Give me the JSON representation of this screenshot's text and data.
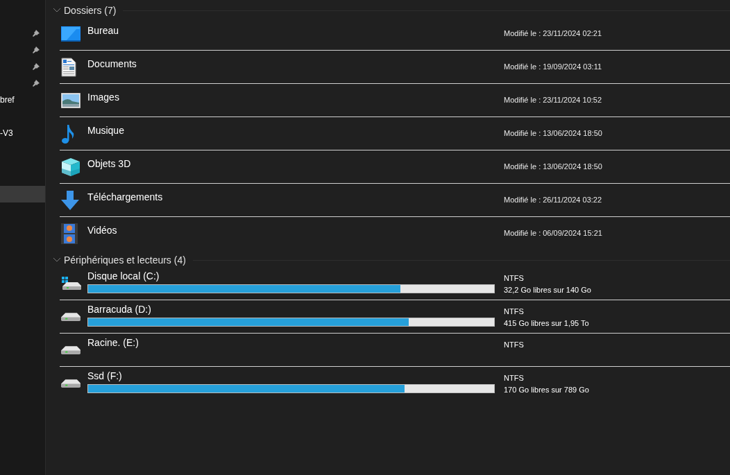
{
  "sidebar": {
    "items": [
      {
        "pinned": true,
        "selected": false
      },
      {
        "pinned": true,
        "selected": false
      },
      {
        "pinned": true,
        "selected": false
      },
      {
        "pinned": true,
        "selected": false
      },
      {
        "label": "bref",
        "pinned": false,
        "selected": false
      },
      {
        "label": "-V3",
        "pinned": false,
        "selected": false
      },
      {
        "pinned": false,
        "selected": true
      }
    ]
  },
  "groups": [
    {
      "title": "Dossiers (7)",
      "expanded": true,
      "kind": "folders",
      "items": [
        {
          "name": "Bureau",
          "detail": "Modifié le : 23/11/2024 02:21"
        },
        {
          "name": "Documents",
          "detail": "Modifié le : 19/09/2024 03:11"
        },
        {
          "name": "Images",
          "detail": "Modifié le : 23/11/2024 10:52"
        },
        {
          "name": "Musique",
          "detail": "Modifié le : 13/06/2024 18:50"
        },
        {
          "name": "Objets 3D",
          "detail": "Modifié le : 13/06/2024 18:50"
        },
        {
          "name": "Téléchargements",
          "detail": "Modifié le : 26/11/2024 03:22"
        },
        {
          "name": "Vidéos",
          "detail": "Modifié le : 06/09/2024 15:21"
        }
      ]
    },
    {
      "title": "Périphériques et lecteurs (4)",
      "expanded": true,
      "kind": "drives",
      "items": [
        {
          "name": "Disque local (C:)",
          "kind": "system",
          "filesystem": "NTFS",
          "level": 0.77,
          "space": "32,2 Go libres sur 140 Go"
        },
        {
          "name": "Barracuda (D:)",
          "kind": "drive",
          "filesystem": "NTFS",
          "level": 0.79,
          "space": "415 Go libres sur 1,95 To"
        },
        {
          "name": "Racine. (E:)",
          "kind": "drive",
          "filesystem": "NTFS"
        },
        {
          "name": "Ssd (F:)",
          "kind": "drive",
          "filesystem": "NTFS",
          "level": 0.78,
          "space": "170 Go libres sur 789 Go"
        }
      ]
    }
  ]
}
